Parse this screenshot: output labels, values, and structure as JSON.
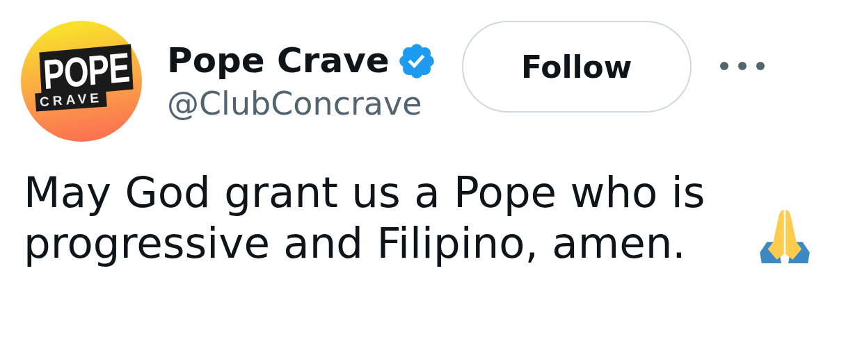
{
  "author": {
    "avatar_text": [
      "POPE",
      "CRAVE"
    ],
    "name": "Pope Crave",
    "verified": true,
    "handle": "@ClubConcrave"
  },
  "follow_button": {
    "label": "Follow"
  },
  "tweet": {
    "text": "May God grant us a Pope who is progressive and Filipino, amen."
  }
}
